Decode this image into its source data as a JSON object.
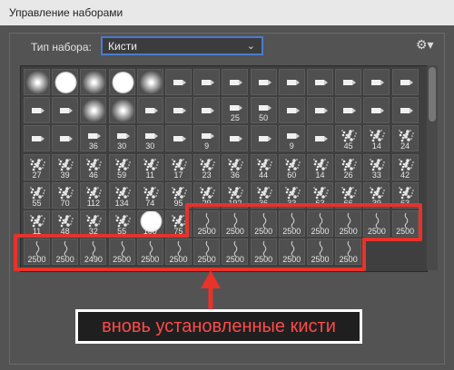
{
  "window": {
    "title": "Управление наборами"
  },
  "preset": {
    "type_label": "Тип набора:",
    "selected": "Кисти"
  },
  "icons": {
    "settings": "gear-icon",
    "dropdown": "chevron-down-icon"
  },
  "colors": {
    "highlight": "#e8322a",
    "focus": "#4a7bd1",
    "panel": "#535353"
  },
  "brushes": [
    {
      "label": "",
      "kind": "soft"
    },
    {
      "label": "",
      "kind": "hard"
    },
    {
      "label": "",
      "kind": "soft"
    },
    {
      "label": "",
      "kind": "hard"
    },
    {
      "label": "",
      "kind": "soft"
    },
    {
      "label": "",
      "kind": "tip"
    },
    {
      "label": "",
      "kind": "tip"
    },
    {
      "label": "",
      "kind": "tip"
    },
    {
      "label": "",
      "kind": "tip"
    },
    {
      "label": "",
      "kind": "tip"
    },
    {
      "label": "",
      "kind": "tip"
    },
    {
      "label": "",
      "kind": "tip"
    },
    {
      "label": "",
      "kind": "tip"
    },
    {
      "label": "",
      "kind": "tip"
    },
    {
      "label": "",
      "kind": "tip"
    },
    {
      "label": "",
      "kind": "tip"
    },
    {
      "label": "",
      "kind": "soft"
    },
    {
      "label": "",
      "kind": "soft"
    },
    {
      "label": "",
      "kind": "tip"
    },
    {
      "label": "",
      "kind": "tip"
    },
    {
      "label": "",
      "kind": "tip"
    },
    {
      "label": "25",
      "kind": "tip"
    },
    {
      "label": "50",
      "kind": "tip"
    },
    {
      "label": "",
      "kind": "tip"
    },
    {
      "label": "",
      "kind": "tip"
    },
    {
      "label": "",
      "kind": "tip"
    },
    {
      "label": "",
      "kind": "tip"
    },
    {
      "label": "",
      "kind": "tip"
    },
    {
      "label": "",
      "kind": "tip"
    },
    {
      "label": "",
      "kind": "tip"
    },
    {
      "label": "36",
      "kind": "tip"
    },
    {
      "label": "30",
      "kind": "tip"
    },
    {
      "label": "30",
      "kind": "tip"
    },
    {
      "label": "",
      "kind": "tip"
    },
    {
      "label": "9",
      "kind": "tip"
    },
    {
      "label": "",
      "kind": "tip"
    },
    {
      "label": "",
      "kind": "tip"
    },
    {
      "label": "9",
      "kind": "tip"
    },
    {
      "label": "",
      "kind": "tip"
    },
    {
      "label": "45",
      "kind": "tex"
    },
    {
      "label": "14",
      "kind": "tex"
    },
    {
      "label": "24",
      "kind": "tex"
    },
    {
      "label": "27",
      "kind": "tex"
    },
    {
      "label": "39",
      "kind": "tex"
    },
    {
      "label": "46",
      "kind": "tex"
    },
    {
      "label": "59",
      "kind": "tex"
    },
    {
      "label": "11",
      "kind": "tex"
    },
    {
      "label": "17",
      "kind": "tex"
    },
    {
      "label": "23",
      "kind": "tex"
    },
    {
      "label": "36",
      "kind": "tex"
    },
    {
      "label": "44",
      "kind": "tex"
    },
    {
      "label": "60",
      "kind": "tex"
    },
    {
      "label": "14",
      "kind": "tex"
    },
    {
      "label": "26",
      "kind": "tex"
    },
    {
      "label": "33",
      "kind": "tex"
    },
    {
      "label": "42",
      "kind": "tex"
    },
    {
      "label": "55",
      "kind": "tex"
    },
    {
      "label": "70",
      "kind": "tex"
    },
    {
      "label": "112",
      "kind": "tex"
    },
    {
      "label": "134",
      "kind": "tex"
    },
    {
      "label": "74",
      "kind": "tex"
    },
    {
      "label": "95",
      "kind": "tex"
    },
    {
      "label": "29",
      "kind": "tex"
    },
    {
      "label": "192",
      "kind": "tex"
    },
    {
      "label": "36",
      "kind": "tex"
    },
    {
      "label": "33",
      "kind": "tex"
    },
    {
      "label": "63",
      "kind": "tex"
    },
    {
      "label": "66",
      "kind": "tex"
    },
    {
      "label": "39",
      "kind": "tex"
    },
    {
      "label": "63",
      "kind": "tex"
    },
    {
      "label": "11",
      "kind": "tex"
    },
    {
      "label": "48",
      "kind": "tex"
    },
    {
      "label": "32",
      "kind": "tex"
    },
    {
      "label": "55",
      "kind": "tex"
    },
    {
      "label": "100",
      "kind": "hard"
    },
    {
      "label": "75",
      "kind": "tex"
    },
    {
      "label": "2500",
      "kind": "stroke"
    },
    {
      "label": "2500",
      "kind": "stroke"
    },
    {
      "label": "2500",
      "kind": "stroke"
    },
    {
      "label": "2500",
      "kind": "stroke"
    },
    {
      "label": "2500",
      "kind": "stroke"
    },
    {
      "label": "2500",
      "kind": "stroke"
    },
    {
      "label": "2500",
      "kind": "stroke"
    },
    {
      "label": "2500",
      "kind": "stroke"
    },
    {
      "label": "2500",
      "kind": "stroke"
    },
    {
      "label": "2500",
      "kind": "stroke"
    },
    {
      "label": "2490",
      "kind": "stroke"
    },
    {
      "label": "2500",
      "kind": "stroke"
    },
    {
      "label": "2500",
      "kind": "stroke"
    },
    {
      "label": "2500",
      "kind": "stroke"
    },
    {
      "label": "2500",
      "kind": "stroke"
    },
    {
      "label": "2500",
      "kind": "stroke"
    },
    {
      "label": "2500",
      "kind": "stroke"
    },
    {
      "label": "2500",
      "kind": "stroke"
    },
    {
      "label": "2500",
      "kind": "stroke"
    },
    {
      "label": "2500",
      "kind": "stroke"
    }
  ],
  "annotation": {
    "text": "вновь установленные кисти"
  }
}
